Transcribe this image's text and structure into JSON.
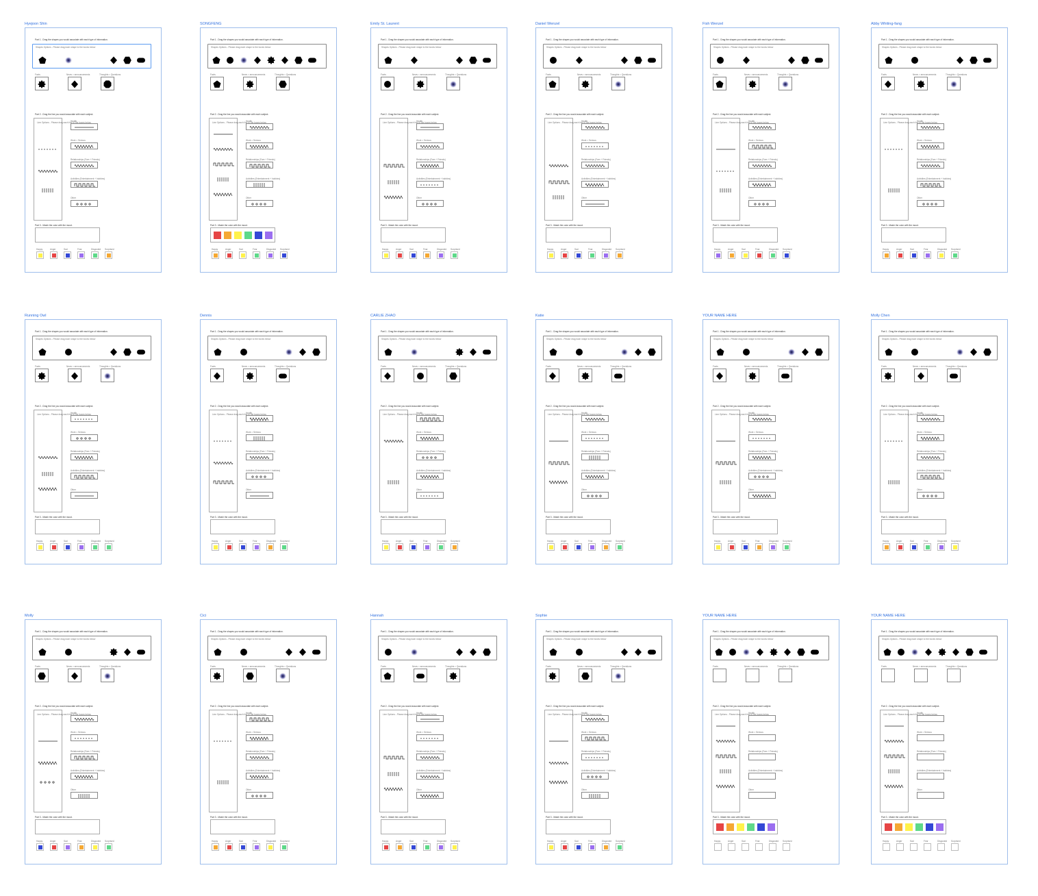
{
  "labels": {
    "part1": "Part 1 - Drag the shapes you would associate with each type of information.",
    "shapes_hint": "Shapes Options - Please drag each shape to the boxes below",
    "cat1": "Facts",
    "cat2": "News = announcements",
    "cat3": "Thoughts = Questions",
    "part2": "Part 2 - Drag the line you would associate with each subject.",
    "lines_hint": "Line Options - Please drag each line to the boxes below",
    "sub1": "Health",
    "sub2": "Work = Serious",
    "sub3": "Relationships (Fam + Friends)",
    "sub4": "Activities (Entertainment + hobbies)",
    "sub5": "Other",
    "part3": "Part 3 - Match the color with the mood.",
    "mood1": "Happy",
    "mood2": "Anger",
    "mood3": "Sad",
    "mood4": "Fear",
    "mood5": "Disgusted",
    "mood6": "Surprised"
  },
  "palette": {
    "yellow": "#fff24a",
    "red": "#e64545",
    "blue": "#3448d6",
    "purple": "#9b6ef0",
    "green": "#5ed989",
    "orange": "#f5a833"
  },
  "frames": [
    {
      "name": "Hyejoon Shin",
      "top": [
        "pentagon",
        "blur",
        "diamond",
        "hexagon",
        "pill"
      ],
      "drops": [
        "star",
        "diamond",
        "octagon"
      ],
      "left": [
        "dashed",
        "wavy",
        "ticks"
      ],
      "right": [
        "straight",
        "zigzag",
        "wavy",
        "square",
        "dotted"
      ],
      "colTop": [],
      "colors": [
        "yellow",
        "red",
        "blue",
        "purple",
        "green",
        "orange"
      ]
    },
    {
      "name": "SONGFENG",
      "top": [
        "pentagon",
        "circle",
        "blur",
        "diamond",
        "star",
        "diamond",
        "hexagon",
        "pill"
      ],
      "drops": [
        "pentagon",
        "star",
        "hexagon"
      ],
      "left": [
        "straight",
        "wavy",
        "square",
        "ticks",
        "zigzag"
      ],
      "right": [
        "wavy",
        "zigzag",
        "square",
        "ticks",
        "dotted"
      ],
      "colTop": [
        "red",
        "orange",
        "yellow",
        "green",
        "blue",
        "purple"
      ],
      "colors": [
        "orange",
        "red",
        "yellow",
        "green",
        "purple",
        "blue"
      ]
    },
    {
      "name": "Emily St. Laurent",
      "top": [
        "pentagon",
        "diamond",
        "diamond",
        "hexagon",
        "pill"
      ],
      "drops": [
        "circle",
        "star",
        "blur"
      ],
      "left": [
        "square",
        "ticks",
        "zigzag"
      ],
      "right": [
        "straight",
        "wavy",
        "zigzag",
        "dashed",
        "dotted"
      ],
      "colTop": [],
      "colors": [
        "yellow",
        "red",
        "blue",
        "orange",
        "purple",
        "green"
      ]
    },
    {
      "name": "Daniel Wenzel",
      "top": [
        "circle",
        "diamond",
        "diamond",
        "hexagon",
        "pill"
      ],
      "drops": [
        "pentagon",
        "star",
        "blur"
      ],
      "left": [
        "wavy",
        "square",
        "ticks"
      ],
      "right": [
        "wavy",
        "dashed",
        "wavy",
        "zigzag",
        "straight"
      ],
      "colTop": [],
      "colors": [
        "yellow",
        "red",
        "blue",
        "green",
        "purple",
        "orange"
      ]
    },
    {
      "name": "Fish Wenzel",
      "top": [
        "circle",
        "diamond",
        "diamond",
        "hexagon",
        "pill"
      ],
      "drops": [
        "pentagon",
        "star",
        "blur"
      ],
      "left": [
        "straight",
        "dashed",
        "ticks"
      ],
      "right": [
        "wavy",
        "square",
        "wavy",
        "zigzag",
        "dotted"
      ],
      "colTop": [],
      "colors": [
        "purple",
        "orange",
        "yellow",
        "red",
        "green",
        "blue"
      ]
    },
    {
      "name": "Abby Whiting-fang",
      "top": [
        "pentagon",
        "circle",
        "diamond",
        "hexagon",
        "pill"
      ],
      "drops": [
        "diamond",
        "star",
        "blur"
      ],
      "left": [
        "dashed",
        "ticks"
      ],
      "right": [
        "wavy",
        "zigzag",
        "wavy",
        "square",
        "dotted"
      ],
      "colTop": [],
      "colors": [
        "orange",
        "red",
        "blue",
        "purple",
        "yellow",
        "green"
      ]
    },
    {
      "name": "Running Owl",
      "top": [
        "pentagon",
        "circle",
        "diamond",
        "hexagon",
        "pill"
      ],
      "drops": [
        "star",
        "diamond",
        "blur"
      ],
      "left": [
        "wavy",
        "ticks",
        "zigzag"
      ],
      "right": [
        "dashed",
        "dotted",
        "zigzag",
        "square",
        "straight"
      ],
      "colTop": [],
      "colors": [
        "yellow",
        "red",
        "blue",
        "purple",
        "green",
        "green"
      ]
    },
    {
      "name": "Dennis",
      "top": [
        "pentagon",
        "circle",
        "blur",
        "diamond",
        "hexagon"
      ],
      "drops": [
        "diamond",
        "star",
        "pill"
      ],
      "left": [
        "dashed",
        "wavy",
        "square"
      ],
      "right": [
        "zigzag",
        "ticks",
        "wavy",
        "dotted",
        "straight"
      ],
      "colTop": [],
      "colors": [
        "yellow",
        "red",
        "blue",
        "purple",
        "orange",
        "green"
      ]
    },
    {
      "name": "CARLIE ZHAO",
      "top": [
        "pentagon",
        "blur",
        "star",
        "diamond",
        "pill"
      ],
      "drops": [
        "diamond",
        "circle",
        "hexagon"
      ],
      "left": [
        "wavy",
        "ticks"
      ],
      "right": [
        "square",
        "zigzag",
        "dotted",
        "zigzag",
        "dashed"
      ],
      "colTop": [],
      "colors": [
        "yellow",
        "red",
        "blue",
        "purple",
        "green",
        "orange"
      ]
    },
    {
      "name": "Katie",
      "top": [
        "pentagon",
        "circle",
        "blur",
        "diamond",
        "hexagon"
      ],
      "drops": [
        "diamond",
        "star",
        "pill"
      ],
      "left": [
        "straight",
        "square",
        "zigzag"
      ],
      "right": [
        "wavy",
        "dashed",
        "ticks",
        "zigzag",
        "dotted"
      ],
      "colTop": [],
      "colors": [
        "yellow",
        "red",
        "blue",
        "purple",
        "orange",
        "green"
      ]
    },
    {
      "name": "YOUR NAME HERE",
      "top": [
        "pentagon",
        "circle",
        "blur",
        "diamond",
        "hexagon"
      ],
      "drops": [
        "diamond",
        "star",
        "pill"
      ],
      "left": [
        "straight",
        "square",
        "ticks"
      ],
      "right": [
        "wavy",
        "dashed",
        "zigzag",
        "dotted",
        "zigzag"
      ],
      "colTop": [],
      "colors": [
        "yellow",
        "red",
        "blue",
        "orange",
        "purple",
        "green"
      ]
    },
    {
      "name": "Molly Chen",
      "top": [
        "pentagon",
        "circle",
        "blur",
        "diamond",
        "hexagon"
      ],
      "drops": [
        "star",
        "diamond",
        "pill"
      ],
      "left": [
        "dashed",
        "ticks"
      ],
      "right": [
        "wavy",
        "zigzag",
        "wavy",
        "square",
        "dotted"
      ],
      "colTop": [],
      "colors": [
        "orange",
        "red",
        "blue",
        "green",
        "purple",
        "yellow"
      ]
    },
    {
      "name": "Molly",
      "top": [
        "pentagon",
        "circle",
        "star",
        "diamond",
        "pill"
      ],
      "drops": [
        "hexagon",
        "diamond",
        "blur"
      ],
      "left": [
        "straight",
        "zigzag",
        "dotted"
      ],
      "right": [
        "wavy",
        "dashed",
        "square",
        "zigzag",
        "ticks"
      ],
      "colTop": [],
      "colors": [
        "blue",
        "red",
        "purple",
        "orange",
        "yellow",
        "green"
      ]
    },
    {
      "name": "Cici",
      "top": [
        "pentagon",
        "circle",
        "diamond",
        "diamond",
        "pill"
      ],
      "drops": [
        "star",
        "hexagon",
        "blur"
      ],
      "left": [
        "dashed",
        "ticks"
      ],
      "right": [
        "square",
        "zigzag",
        "wavy",
        "zigzag",
        "dotted"
      ],
      "colTop": [],
      "colors": [
        "orange",
        "red",
        "blue",
        "purple",
        "yellow",
        "green"
      ]
    },
    {
      "name": "Hannah",
      "top": [
        "circle",
        "blur",
        "diamond",
        "diamond",
        "hexagon"
      ],
      "drops": [
        "pentagon",
        "pill",
        "star"
      ],
      "left": [
        "square",
        "ticks",
        "zigzag"
      ],
      "right": [
        "straight",
        "dashed",
        "wavy",
        "wavy",
        "zigzag"
      ],
      "colTop": [],
      "colors": [
        "red",
        "orange",
        "blue",
        "green",
        "purple",
        "yellow"
      ]
    },
    {
      "name": "Sophie",
      "top": [
        "pentagon",
        "circle",
        "diamond",
        "diamond",
        "pill"
      ],
      "drops": [
        "star",
        "hexagon",
        "blur"
      ],
      "left": [
        "straight",
        "wavy",
        "zigzag"
      ],
      "right": [
        "wavy",
        "square",
        "dashed",
        "dotted",
        "ticks"
      ],
      "colTop": [],
      "colors": [
        "yellow",
        "red",
        "blue",
        "purple",
        "orange",
        "green"
      ]
    },
    {
      "name": "YOUR NAME HERE",
      "top": [
        "pentagon",
        "circle",
        "blur",
        "diamond",
        "star",
        "diamond",
        "hexagon",
        "pill"
      ],
      "drops": [],
      "left": [
        "straight",
        "wavy",
        "square",
        "ticks",
        "zigzag"
      ],
      "right": [],
      "colTop": [
        "red",
        "orange",
        "yellow",
        "green",
        "blue",
        "purple"
      ],
      "colors": []
    },
    {
      "name": "YOUR NAME HERE",
      "top": [
        "pentagon",
        "circle",
        "blur",
        "diamond",
        "star",
        "diamond",
        "hexagon",
        "pill"
      ],
      "drops": [],
      "left": [
        "straight",
        "wavy",
        "square",
        "ticks",
        "zigzag"
      ],
      "right": [],
      "colTop": [
        "red",
        "orange",
        "yellow",
        "green",
        "blue",
        "purple"
      ],
      "colors": []
    }
  ]
}
